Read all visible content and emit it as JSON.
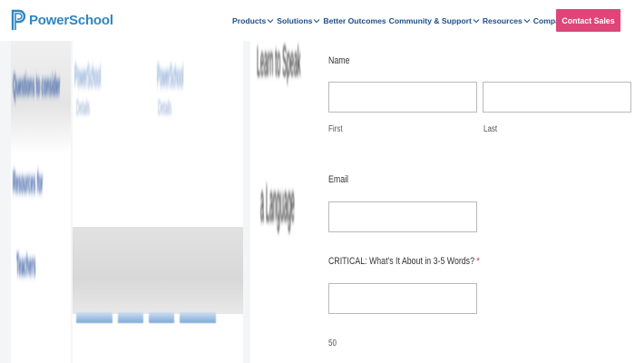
{
  "brand": {
    "name": "PowerSchool",
    "color": "#2f86c4",
    "cta_color": "#de4578"
  },
  "nav": {
    "items": [
      {
        "label": "Products"
      },
      {
        "label": "Solutions"
      },
      {
        "label": "Better Outcomes"
      },
      {
        "label": "Community & Support"
      },
      {
        "label": "Resources"
      },
      {
        "label": "Company"
      }
    ],
    "cta_label": "Contact Sales"
  },
  "blurred_content": {
    "left_column": [
      "Questions to consider",
      "Resources for",
      "Teachers"
    ],
    "cards": [
      "PowerSchool",
      "Details",
      "PowerSchool",
      "Details"
    ],
    "middle_strip": [
      "Learn to Speak",
      "a Language"
    ]
  },
  "form": {
    "name_label": "Name",
    "first_label": "First",
    "last_label": "Last",
    "email_label": "Email",
    "critical_label": "CRITICAL: What's It About in 3-5 Words?",
    "required_marker": "*",
    "counter": "50"
  }
}
